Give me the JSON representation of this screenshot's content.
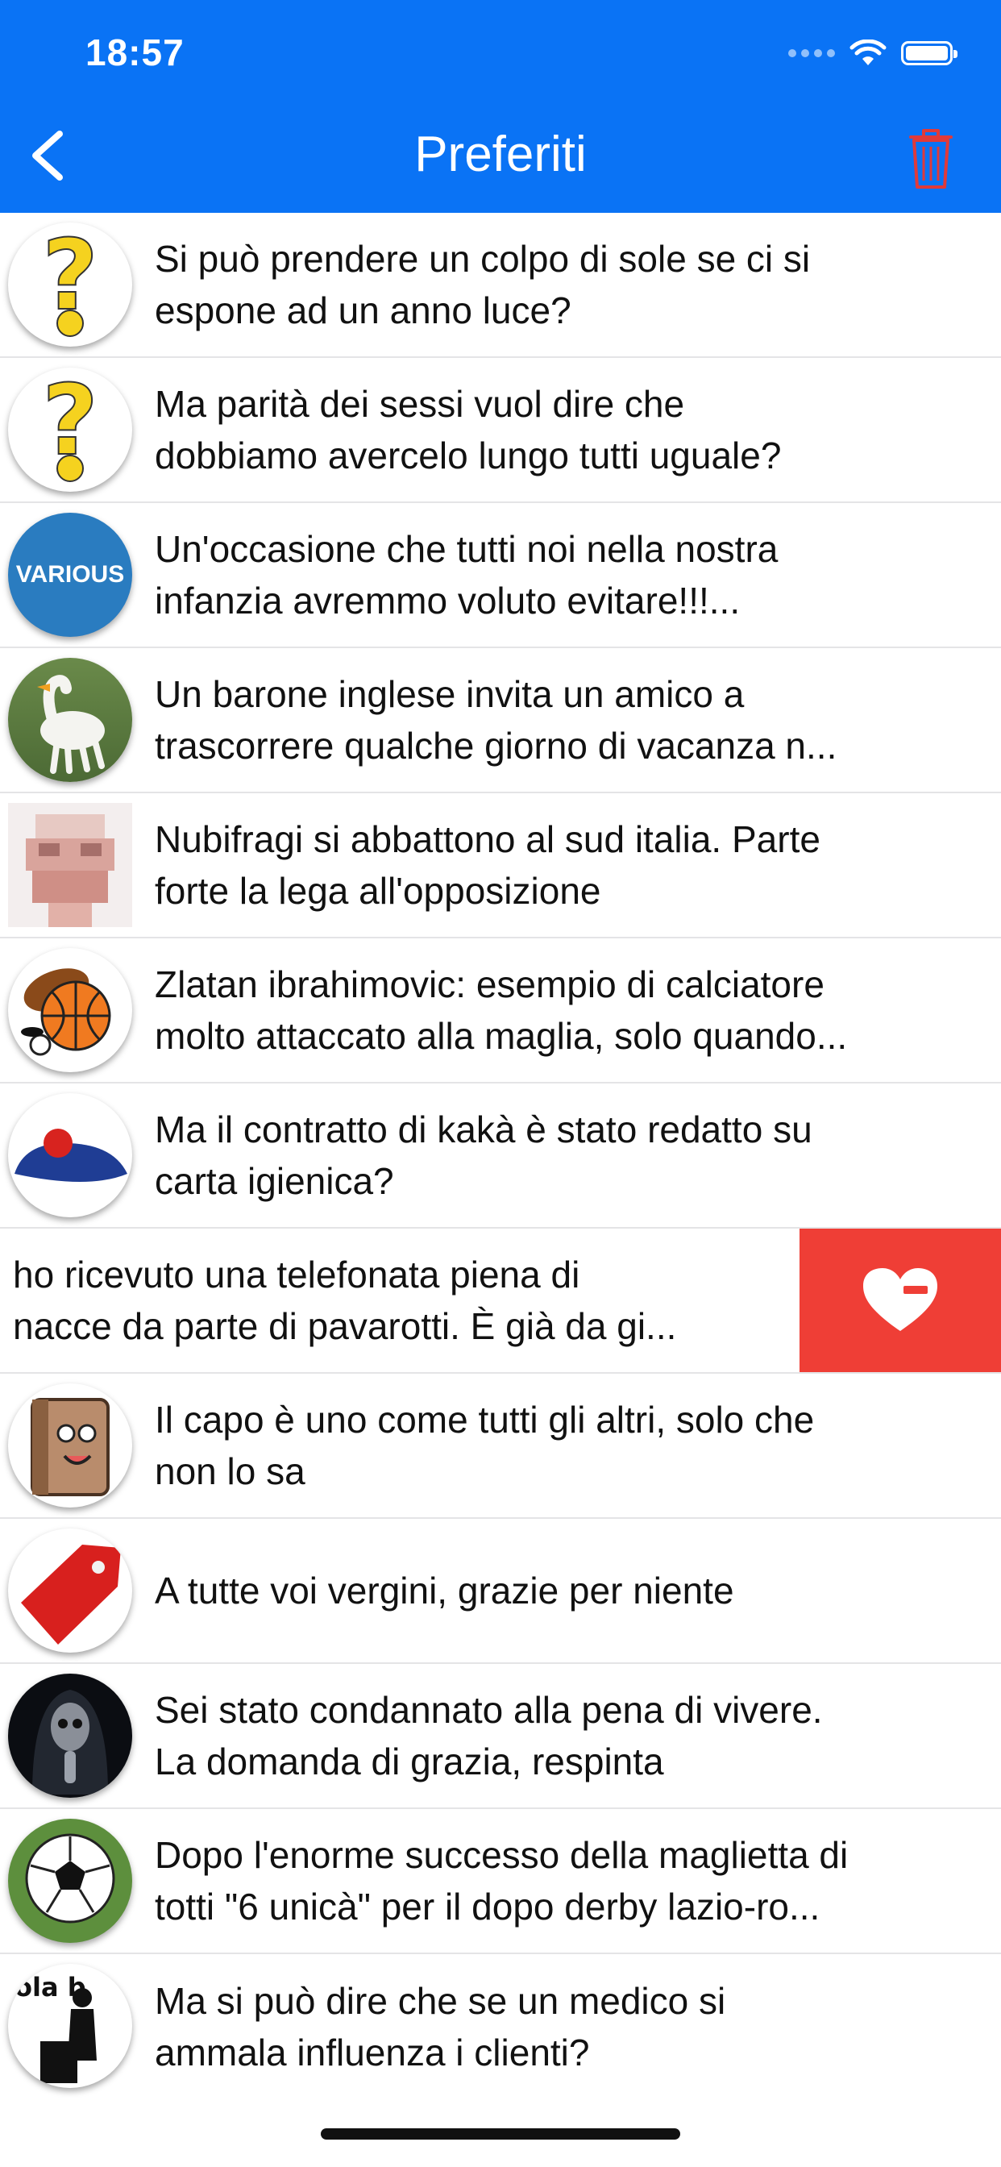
{
  "status_bar": {
    "time": "18:57"
  },
  "nav": {
    "title": "Preferiti"
  },
  "items": [
    {
      "lines": [
        "Si può prendere un colpo di sole se ci si",
        "espone ad un anno luce?"
      ]
    },
    {
      "lines": [
        "Ma parità dei sessi vuol dire che",
        "dobbiamo avercelo lungo tutti uguale?"
      ]
    },
    {
      "lines": [
        "Un'occasione che tutti noi nella nostra",
        "infanzia avremmo voluto evitare!!!..."
      ],
      "avatar_text": "VARIOUS"
    },
    {
      "lines": [
        "Un barone inglese invita un amico a",
        "trascorrere qualche giorno di vacanza n..."
      ]
    },
    {
      "lines": [
        "Nubifragi si abbattono al sud italia. Parte",
        "forte la lega all'opposizione"
      ]
    },
    {
      "lines": [
        "Zlatan ibrahimovic: esempio di calciatore",
        "molto attaccato alla maglia, solo quando..."
      ]
    },
    {
      "lines": [
        "Ma il contratto di kakà è stato redatto su",
        "carta igienica?"
      ]
    },
    {
      "lines": [
        "ho ricevuto una telefonata piena di",
        "nacce da parte di pavarotti. È già da gi..."
      ]
    },
    {
      "lines": [
        "Il capo è uno come tutti gli altri, solo che",
        "non lo sa"
      ]
    },
    {
      "lines": [
        "A tutte voi vergini, grazie per niente"
      ]
    },
    {
      "lines": [
        "Sei stato condannato alla pena di vivere.",
        "La domanda di grazia, respinta"
      ]
    },
    {
      "lines": [
        "Dopo l'enorme successo della maglietta di",
        "totti \"6 unicà\" per il dopo derby lazio-ro..."
      ]
    },
    {
      "lines": [
        "Ma si può dire che se un medico si",
        "ammala influenza i clienti?"
      ],
      "avatar_text": "ola b"
    }
  ],
  "colors": {
    "header": "#0a73f5",
    "delete_action": "#ef3e36",
    "trash_icon": "#e03a3a"
  }
}
